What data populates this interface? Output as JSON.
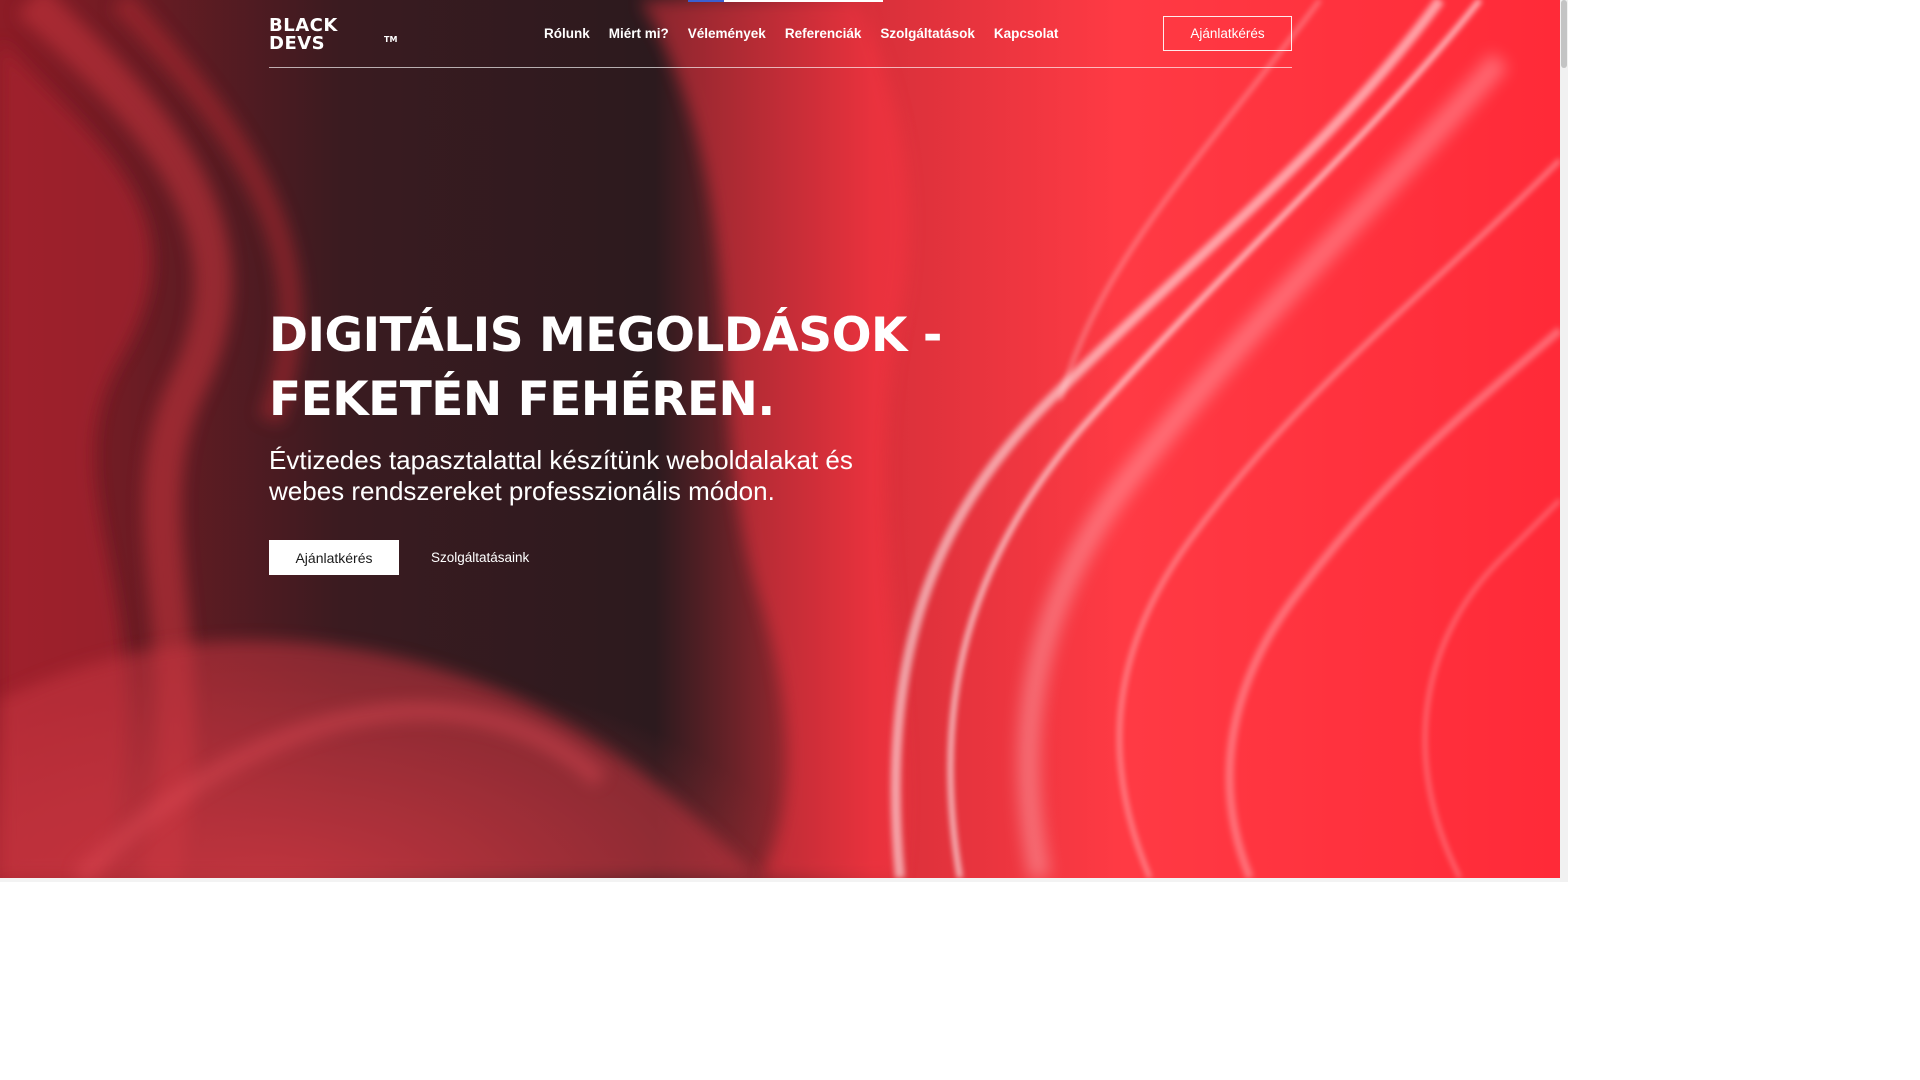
{
  "logo": {
    "line1": "BLACK",
    "line2": "DEVS",
    "trademark": "TM"
  },
  "nav": {
    "items": [
      {
        "label": "Rólunk"
      },
      {
        "label": "Miért mi?"
      },
      {
        "label": "Vélemények"
      },
      {
        "label": "Referenciák"
      },
      {
        "label": "Szolgáltatások"
      },
      {
        "label": "Kapcsolat"
      }
    ]
  },
  "header": {
    "cta_label": "Ajánlatkérés"
  },
  "hero": {
    "title_line1": "DIGITÁLIS MEGOLDÁSOK -",
    "title_line2": "FEKETÉN FEHÉREN.",
    "subtitle_line1": "Évtizedes tapasztalattal készítünk weboldalakat és",
    "subtitle_line2": "webes rendszereket professzionális módon.",
    "primary_button": "Ajánlatkérés",
    "secondary_button": "Szolgáltatásaink"
  },
  "colors": {
    "dark_wave": "#2a1a1e",
    "mid_red": "#c22d36",
    "bright_red": "#ff2d3a",
    "text": "#ffffff"
  }
}
